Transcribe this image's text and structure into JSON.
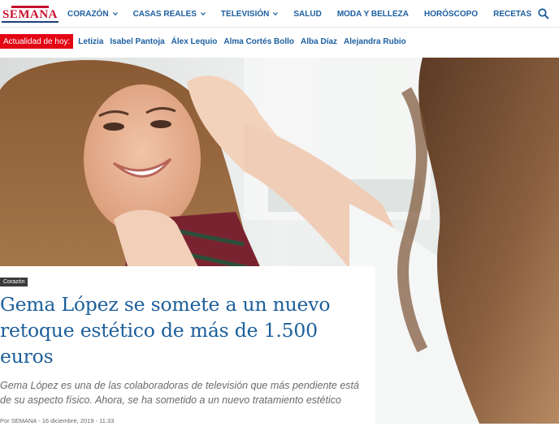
{
  "header": {
    "logo_text": "SEMANA",
    "nav": [
      {
        "label": "CORAZÓN",
        "has_dropdown": true
      },
      {
        "label": "CASAS REALES",
        "has_dropdown": true
      },
      {
        "label": "TELEVISIÓN",
        "has_dropdown": true
      },
      {
        "label": "SALUD",
        "has_dropdown": false
      },
      {
        "label": "MODA Y BELLEZA",
        "has_dropdown": false
      },
      {
        "label": "HORÓSCOPO",
        "has_dropdown": false
      },
      {
        "label": "RECETAS",
        "has_dropdown": false
      }
    ],
    "search_icon": "search-icon"
  },
  "trending": {
    "label": "Actualidad de hoy:",
    "links": [
      "Letizia",
      "Isabel Pantoja",
      "Álex Lequio",
      "Alma Cortés Bollo",
      "Alba Díaz",
      "Alejandra Rubio"
    ]
  },
  "article": {
    "category": "Corazón",
    "headline": "Gema López se somete a un nuevo retoque estético de más de 1.500 euros",
    "summary": "Gema López es una de las colaboradoras de televisión que más pendiente está de su aspecto físico. Ahora, se ha sometido a un nuevo tratamiento estético",
    "byline_prefix": "Por",
    "author": "SEMANA",
    "separator": "-",
    "date": "16 diciembre, 2019 - 11:33"
  },
  "colors": {
    "nav_blue": "#1c5fa0",
    "headline_blue": "#1d5f9b",
    "trend_red": "#e30613",
    "logo_red": "#c8102e"
  }
}
